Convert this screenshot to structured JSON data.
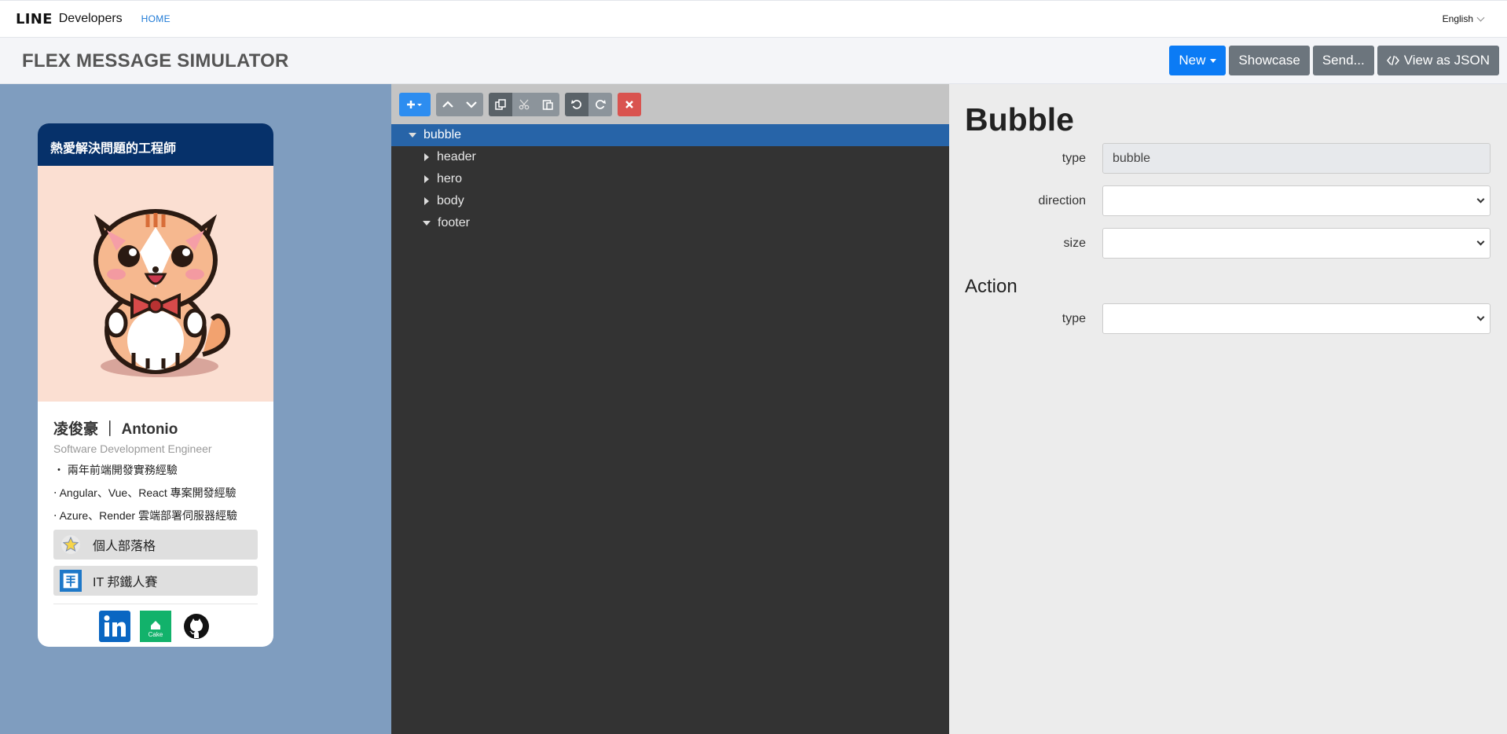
{
  "nav": {
    "logo": "LINE",
    "logo_sub": "Developers",
    "home": "HOME",
    "language": "English"
  },
  "header": {
    "title": "FLEX MESSAGE SIMULATOR",
    "buttons": {
      "new": "New",
      "showcase": "Showcase",
      "send": "Send...",
      "view_json": "View as JSON"
    }
  },
  "preview": {
    "header_text": "熱愛解決問題的工程師",
    "name": "凌俊豪 ｜ Antonio",
    "role": "Software Development Engineer",
    "bullets": [
      "‧ 兩年前端開發實務經驗",
      "‧ Angular、Vue、React 專案開發經驗",
      "‧ Azure、Render 雲端部署伺服器經驗"
    ],
    "links": [
      {
        "label": "個人部落格",
        "icon": "star-icon"
      },
      {
        "label": "IT 邦鐵人賽",
        "icon": "ironman-icon"
      }
    ],
    "socials": [
      "linkedin-icon",
      "cake-icon",
      "github-icon"
    ],
    "social_cake_text": "Cake"
  },
  "tree": {
    "nodes": [
      {
        "label": "bubble",
        "expanded": true,
        "depth": 0,
        "selected": true
      },
      {
        "label": "header",
        "expanded": false,
        "depth": 1
      },
      {
        "label": "hero",
        "expanded": false,
        "depth": 1
      },
      {
        "label": "body",
        "expanded": false,
        "depth": 1
      },
      {
        "label": "footer",
        "expanded": true,
        "depth": 1
      }
    ]
  },
  "props": {
    "title": "Bubble",
    "type_label": "type",
    "type_value": "bubble",
    "direction_label": "direction",
    "direction_value": "",
    "size_label": "size",
    "size_value": "",
    "action_title": "Action",
    "action_type_label": "type",
    "action_type_value": ""
  },
  "colors": {
    "primary": "#0b7bf5",
    "secondary": "#6c757d",
    "selected_node": "#2764a8",
    "card_header": "#06316a",
    "preview_bg": "#7f9dbf"
  }
}
